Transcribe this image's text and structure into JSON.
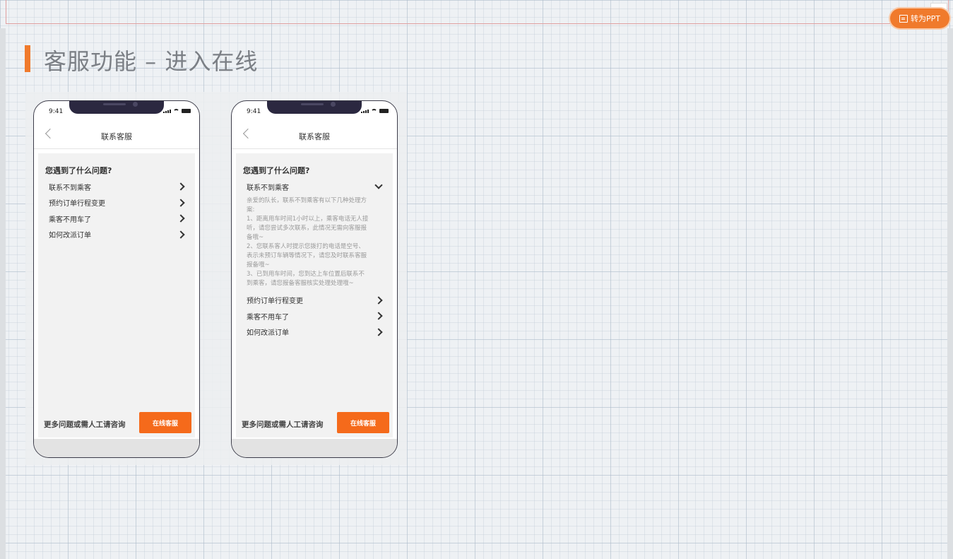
{
  "toolbar": {
    "ppt_button_label": "转为PPT"
  },
  "slide": {
    "title": "客服功能 – 进入在线",
    "accent_color": "#f07a2c"
  },
  "phones": [
    {
      "status_time": "9:41",
      "nav_title": "联系客服",
      "question_heading": "您遇到了什么问题?",
      "items": [
        {
          "label": "联系不到乘客"
        },
        {
          "label": "预约订单行程变更"
        },
        {
          "label": "乘客不用车了"
        },
        {
          "label": "如何改派订单"
        }
      ],
      "footer_text": "更多问题或需人工请咨询",
      "online_button": "在线客服"
    },
    {
      "status_time": "9:41",
      "nav_title": "联系客服",
      "question_heading": "您遇到了什么问题?",
      "expanded_item": {
        "label": "联系不到乘客",
        "answer_lines": [
          "亲爱的队长，联系不到乘客有以下几种处理方",
          "案:",
          "1、距离用车时间1小时以上，乘客电话无人接",
          "听，请您尝试多次联系，此情况无需向客服报",
          "备哦~",
          "2、您联系客人时提示您拨打的电话是空号、",
          "表示未预订车辆等情况下，请您及时联系客服",
          "报备哦~",
          "3、已到用车时间，您到达上车位置后联系不",
          "到乘客，请您报备客服核实处理处理哦~"
        ]
      },
      "items": [
        {
          "label": "预约订单行程变更"
        },
        {
          "label": "乘客不用车了"
        },
        {
          "label": "如何改派订单"
        }
      ],
      "footer_text": "更多问题或需人工请咨询",
      "online_button": "在线客服"
    }
  ],
  "colors": {
    "button_orange": "#f56a1b",
    "phone_frame": "#3d3d4a"
  }
}
